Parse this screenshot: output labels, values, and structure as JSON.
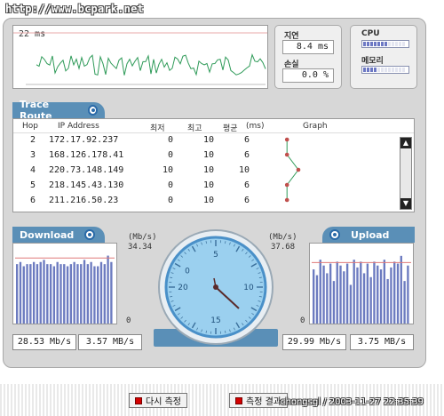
{
  "watermark": "http://www.bcpark.net",
  "latency": {
    "ms_label": "22 ms",
    "delay_label": "지연",
    "delay_value": "8.4 ms",
    "loss_label": "손실",
    "loss_value": "0.0 %",
    "color": "#2e9a58"
  },
  "system": {
    "cpu_label": "CPU",
    "cpu_level": 0.55,
    "memory_label": "메모리",
    "memory_level": 0.35,
    "meter_color": "#6c78c4"
  },
  "trace": {
    "tab_label": "Trace Route",
    "headers": {
      "hop": "Hop",
      "ip": "IP Address",
      "min": "최저",
      "max": "최고",
      "avg": "평균",
      "unit": "(ms)",
      "graph": "Graph"
    },
    "rows": [
      {
        "hop": "2",
        "ip": "172.17.92.237",
        "min": "0",
        "max": "10",
        "avg": "6"
      },
      {
        "hop": "3",
        "ip": "168.126.178.41",
        "min": "0",
        "max": "10",
        "avg": "6"
      },
      {
        "hop": "4",
        "ip": "220.73.148.149",
        "min": "10",
        "max": "10",
        "avg": "10"
      },
      {
        "hop": "5",
        "ip": "218.145.43.130",
        "min": "0",
        "max": "10",
        "avg": "6"
      },
      {
        "hop": "6",
        "ip": "211.216.50.23",
        "min": "0",
        "max": "10",
        "avg": "6"
      }
    ],
    "graph_color": "#2e9a58",
    "point_color": "#c0504d"
  },
  "download": {
    "tab_label": "Download",
    "unit": "(Mb/s)",
    "max": "34.34",
    "min": "0",
    "speed_mbps": "28.53 Mb/s",
    "speed_MBps": "3.57 MB/s",
    "bars": [
      28,
      29,
      27,
      28,
      28,
      29,
      28,
      29,
      30,
      28,
      28,
      27,
      29,
      28,
      28,
      27,
      28,
      29,
      28,
      28,
      30,
      28,
      29,
      27,
      27,
      29,
      28,
      32,
      29
    ],
    "bar_color": "#6c7bc0"
  },
  "upload": {
    "tab_label": "Upload",
    "unit": "(Mb/s)",
    "max": "37.68",
    "min": "0",
    "speed_mbps": "29.99 Mb/s",
    "speed_MBps": "3.75 MB/s",
    "bars": [
      28,
      25,
      33,
      30,
      26,
      31,
      22,
      32,
      30,
      27,
      31,
      20,
      33,
      29,
      32,
      26,
      31,
      24,
      32,
      30,
      28,
      33,
      23,
      29,
      32,
      31,
      35,
      22,
      30
    ],
    "bar_color": "#6c7bc0"
  },
  "gauge": {
    "ticks": [
      "0",
      "5",
      "10",
      "15",
      "20"
    ],
    "face_color": "#9bd0ef",
    "rim_color": "#4a90c8"
  },
  "buttons": {
    "retry": "다시 측정",
    "result": "측정 결과"
  },
  "footer": "chongsgl / 2003-11-27 22:35:39"
}
